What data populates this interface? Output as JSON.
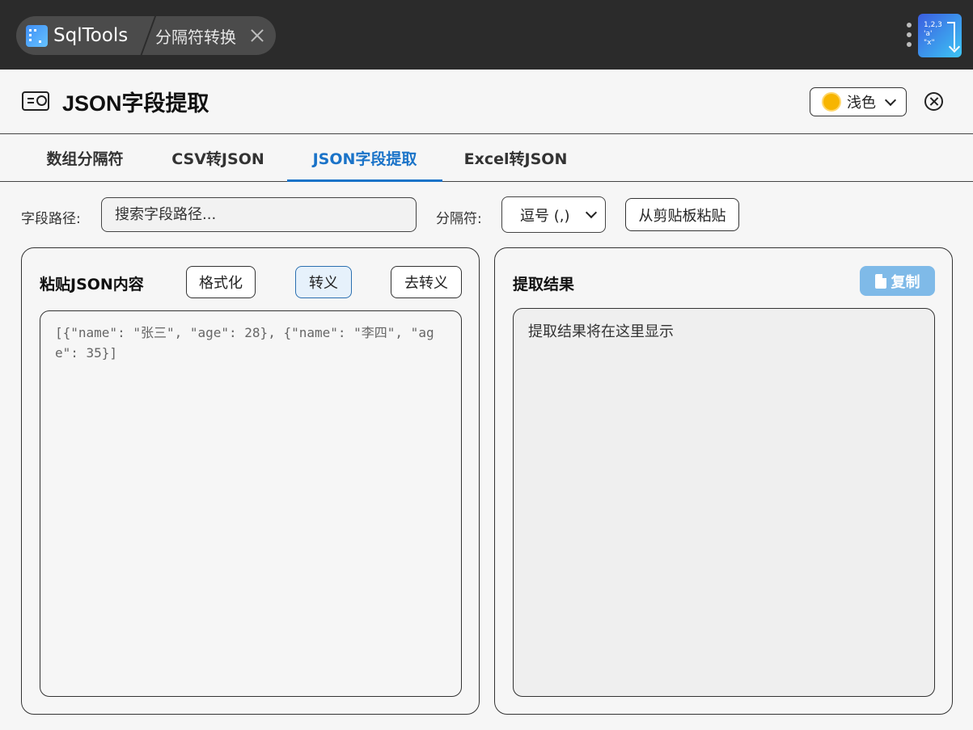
{
  "app": {
    "name": "SqlTools",
    "open_tab": "分隔符转换"
  },
  "corner_icon_lines": [
    "1,2,3",
    "'a'",
    "\"x\""
  ],
  "header": {
    "title": "JSON字段提取",
    "theme": "浅色"
  },
  "tabs": [
    {
      "label": "数组分隔符",
      "active": false
    },
    {
      "label": "CSV转JSON",
      "active": false
    },
    {
      "label": "JSON字段提取",
      "active": true
    },
    {
      "label": "Excel转JSON",
      "active": false
    }
  ],
  "toolbar": {
    "field_path_label": "字段路径:",
    "field_path_placeholder": "搜索字段路径...",
    "separator_label": "分隔符:",
    "separator_value": "逗号 (,)",
    "paste_button": "从剪贴板粘贴"
  },
  "left_panel": {
    "title": "粘贴JSON内容",
    "format_button": "格式化",
    "escape_button": "转义",
    "unescape_button": "去转义",
    "json_content": "[{\"name\": \"张三\", \"age\": 28}, {\"name\": \"李四\", \"age\": 35}]"
  },
  "right_panel": {
    "title": "提取结果",
    "copy_button": "复制",
    "result_placeholder": "提取结果将在这里显示"
  },
  "colors": {
    "accent": "#1a73c8",
    "copy_button": "#7fbae8",
    "titlebar": "#2b2b2b"
  }
}
